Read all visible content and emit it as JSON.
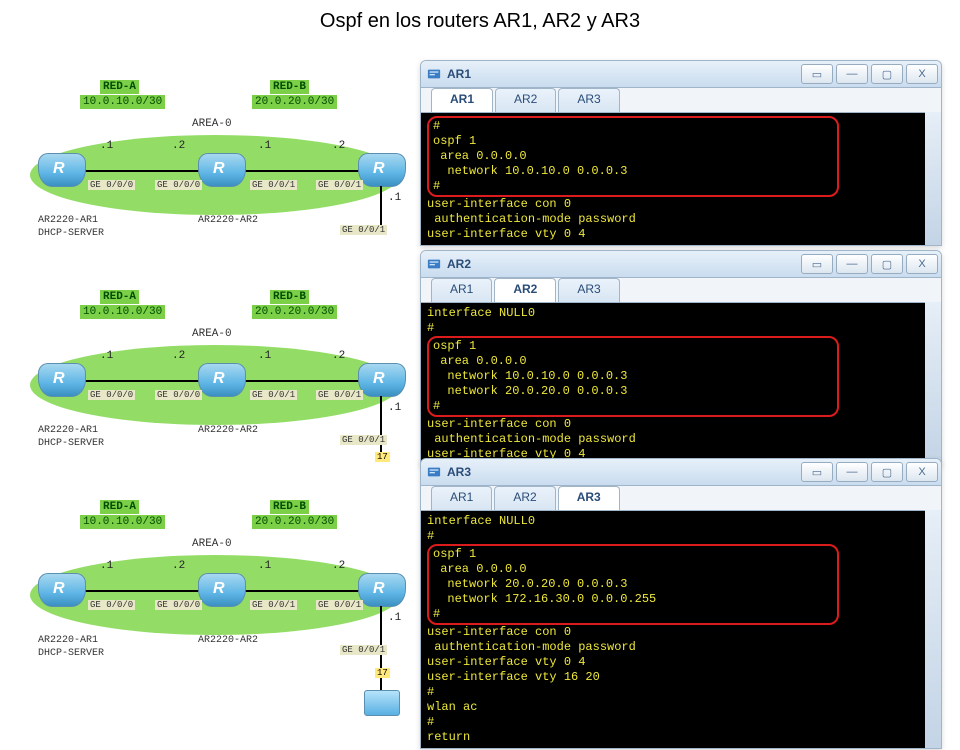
{
  "title": "Ospf en los routers AR1, AR2 y AR3",
  "diagram": {
    "redA": {
      "name": "RED-A",
      "net": "10.0.10.0/30"
    },
    "redB": {
      "name": "RED-B",
      "net": "20.0.20.0/30"
    },
    "area": "AREA-0",
    "r1": {
      "name": "AR2220-AR1",
      "role": "DHCP-SERVER"
    },
    "r2": {
      "name": "AR2220-AR2"
    },
    "ips": {
      "d1": ".1",
      "d2": ".2",
      "d3": ".1",
      "d4": ".2",
      "drop": ".1"
    },
    "intfs": {
      "g000": "GE 0/0/0",
      "g001": "GE 0/0/1",
      "ge001b": "GE 0/0/1"
    },
    "yellow": "17"
  },
  "terminals": {
    "ar1": {
      "title": "AR1",
      "tabs": [
        "AR1",
        "AR2",
        "AR3"
      ],
      "active": "AR1",
      "highlight": "#\nospf 1\n area 0.0.0.0\n  network 10.0.10.0 0.0.0.3\n#",
      "rest": "user-interface con 0\n authentication-mode password\nuser-interface vty 0 4"
    },
    "ar2": {
      "title": "AR2",
      "tabs": [
        "AR1",
        "AR2",
        "AR3"
      ],
      "active": "AR2",
      "pre": "interface NULL0\n#",
      "highlight": "ospf 1\n area 0.0.0.0\n  network 10.0.10.0 0.0.0.3\n  network 20.0.20.0 0.0.0.3\n#",
      "rest": "user-interface con 0\n authentication-mode password\nuser-interface vty 0 4"
    },
    "ar3": {
      "title": "AR3",
      "tabs": [
        "AR1",
        "AR2",
        "AR3"
      ],
      "active": "AR3",
      "pre": "interface NULL0\n#",
      "highlight": "ospf 1\n area 0.0.0.0\n  network 20.0.20.0 0.0.0.3\n  network 172.16.30.0 0.0.0.255\n#",
      "rest": "user-interface con 0\n authentication-mode password\nuser-interface vty 0 4\nuser-interface vty 16 20\n#\nwlan ac\n#\nreturn"
    }
  }
}
